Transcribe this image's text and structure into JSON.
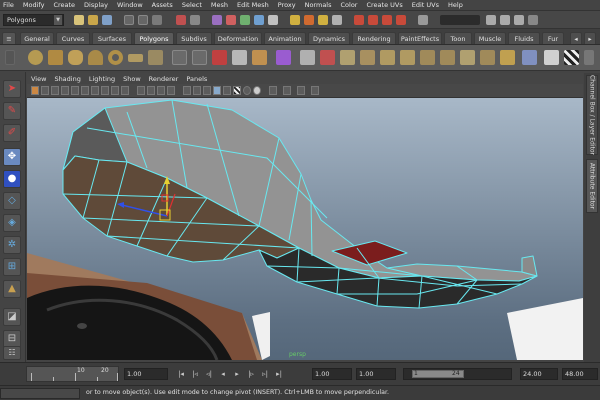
{
  "menubar": {
    "items": [
      "File",
      "Modify",
      "Create",
      "Display",
      "Window",
      "Assets",
      "Select",
      "Mesh",
      "Edit Mesh",
      "Proxy",
      "Normals",
      "Color",
      "Create UVs",
      "Edit UVs",
      "Help"
    ]
  },
  "status_line": {
    "mode_value": "Polygons"
  },
  "shelf": {
    "tabs": [
      "General",
      "Curves",
      "Surfaces",
      "Polygons",
      "Subdivs",
      "Deformation",
      "Animation",
      "Dynamics",
      "Rendering",
      "PaintEffects",
      "Toon",
      "Muscle",
      "Fluids",
      "Fur"
    ],
    "active_tab": "Polygons"
  },
  "panel": {
    "menu": [
      "View",
      "Shading",
      "Lighting",
      "Show",
      "Renderer",
      "Panels"
    ]
  },
  "side_tabs": [
    "Channel Box / Layer Editor",
    "Attribute Editor"
  ],
  "time_slider": {
    "tick_labels": [
      "10",
      "20"
    ],
    "current_frame": "1.00",
    "range_start": "1.00",
    "playback_start": "1.00",
    "range_handle_start": "1",
    "range_handle_end": "24",
    "range_end": "24.00",
    "playback_end": "48.00"
  },
  "help_line": {
    "text": "or to move object(s). Use edit mode to change pivot (INSERT).  Ctrl+LMB to move perpendicular."
  },
  "viewport": {
    "axis_label": "persp"
  },
  "colors": {
    "wireframe": "#68e8f0",
    "face_dark": "#2c2c2c",
    "face_top": "#9a9a9a",
    "selected_face": "#7b1d1d",
    "manip_x": "#e03030",
    "manip_y": "#e8d030",
    "manip_z": "#3050e8"
  }
}
